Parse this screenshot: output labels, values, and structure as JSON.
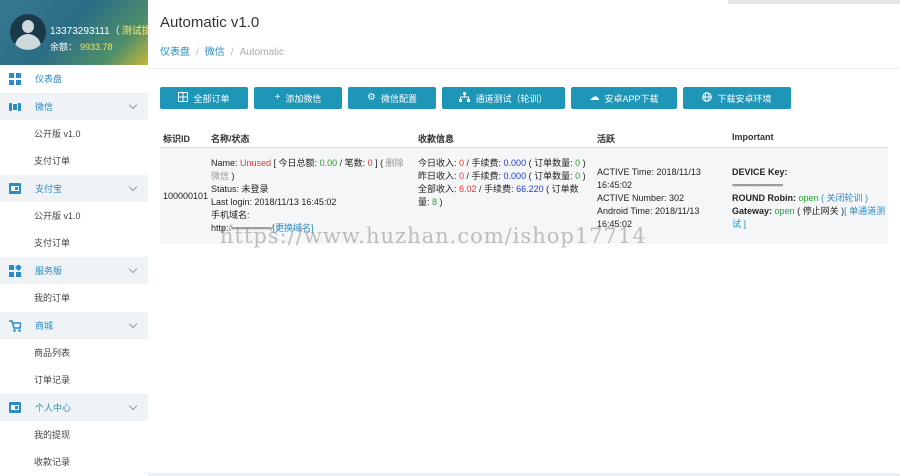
{
  "user": {
    "phone": "13373293111（",
    "tag": "测试提",
    "balance_label": "余额：",
    "balance": "9933.78"
  },
  "sidebar": {
    "groups": [
      {
        "label": "仪表盘",
        "icon": "dashboard-icon",
        "items": []
      },
      {
        "label": "微信",
        "icon": "wechat-icon",
        "items": [
          "公开版 v1.0",
          "支付订单"
        ]
      },
      {
        "label": "支付宝",
        "icon": "alipay-icon",
        "items": [
          "公开版 v1.0",
          "支付订单"
        ]
      },
      {
        "label": "服务版",
        "icon": "service-icon",
        "items": [
          "我的订单"
        ]
      },
      {
        "label": "商城",
        "icon": "cart-icon",
        "items": [
          "商品列表",
          "订单记录"
        ]
      },
      {
        "label": "个人中心",
        "icon": "wallet-icon",
        "items": [
          "我的提现",
          "收款记录"
        ]
      }
    ]
  },
  "page": {
    "title": "Automatic v1.0"
  },
  "breadcrumb": {
    "home": "仪表盘",
    "section": "微信",
    "current": "Automatic",
    "sep": "/"
  },
  "toolbar": {
    "all_orders": "全部订单",
    "add_wechat": "添加微信",
    "wechat_config": "微信配置",
    "channel_test": "通道测试（轮训）",
    "android_download": "安卓APP下载",
    "android_env_download": "下载安卓环境"
  },
  "table": {
    "headers": {
      "id": "标识ID",
      "name": "名称/状态",
      "income": "收款信息",
      "active": "活跃",
      "important": "Important"
    },
    "row": {
      "id": "100000101",
      "name_label": "Name: ",
      "name_value": "Unused",
      "today_total_label": " [ 今日总额: ",
      "today_total": "0.00",
      "count_label": " / 笔数: ",
      "count": "0",
      "delete_pre": " ] ( ",
      "delete": "删除微信",
      "delete_post": " )",
      "status_label": "Status: ",
      "status_value": "未登录",
      "last_login": "Last login: 2018/11/13 16:45:02",
      "domain_label": "手机域名:",
      "domain_prefix": "http:",
      "domain_blur": "//▪▪▪▪▪▪▪▪▪▪▪▪▪▪▪▪▪▪/",
      "change_domain": "[更换域名]",
      "today_income_label": "今日收入: ",
      "today_income": "0",
      "today_fee_label": " / 手续费: ",
      "today_fee": "0.000",
      "today_orders_label": " ( 订单数量: ",
      "today_orders": "0",
      "today_close": " )",
      "yday_income_label": "昨日收入: ",
      "yday_income": "0",
      "yday_fee_label": " / 手续费: ",
      "yday_fee": "0.000",
      "yday_orders_label": " ( 订单数量: ",
      "yday_orders": "0",
      "yday_close": " )",
      "all_income_label": "全部收入: ",
      "all_income": "6.02",
      "all_fee_label": " / 手续费: ",
      "all_fee": "66.220",
      "all_orders_label": " ( 订单数量: ",
      "all_orders": "8",
      "all_close": " )",
      "active_time": "ACTIVE Time: 2018/11/13 16:45:02",
      "active_number": "ACTIVE Number: 302",
      "android_time": "Android Time: 2018/11/13 16:45:02",
      "device_key_label": "DEVICE Key:",
      "device_key_blur": "▪▪▪▪▪▪▪▪▪▪▪▪▪▪▪▪▪▪▪▪▪▪▪",
      "round_robin_label": "ROUND Robin: ",
      "round_robin_value": "open",
      "round_robin_action": "( 关闭轮训 )",
      "gateway_label": "Gateway: ",
      "gateway_value": "open",
      "gateway_action": "( 停止网关 )",
      "single_test": "[ 单通道测试 ]"
    }
  },
  "watermark": "https://www.huzhan.com/ishop17714",
  "colors": {
    "primary": "#1d96b8",
    "link": "#2a8cc4",
    "red": "#e53935",
    "green": "#2e9e2e",
    "blue": "#1f3fd4"
  }
}
